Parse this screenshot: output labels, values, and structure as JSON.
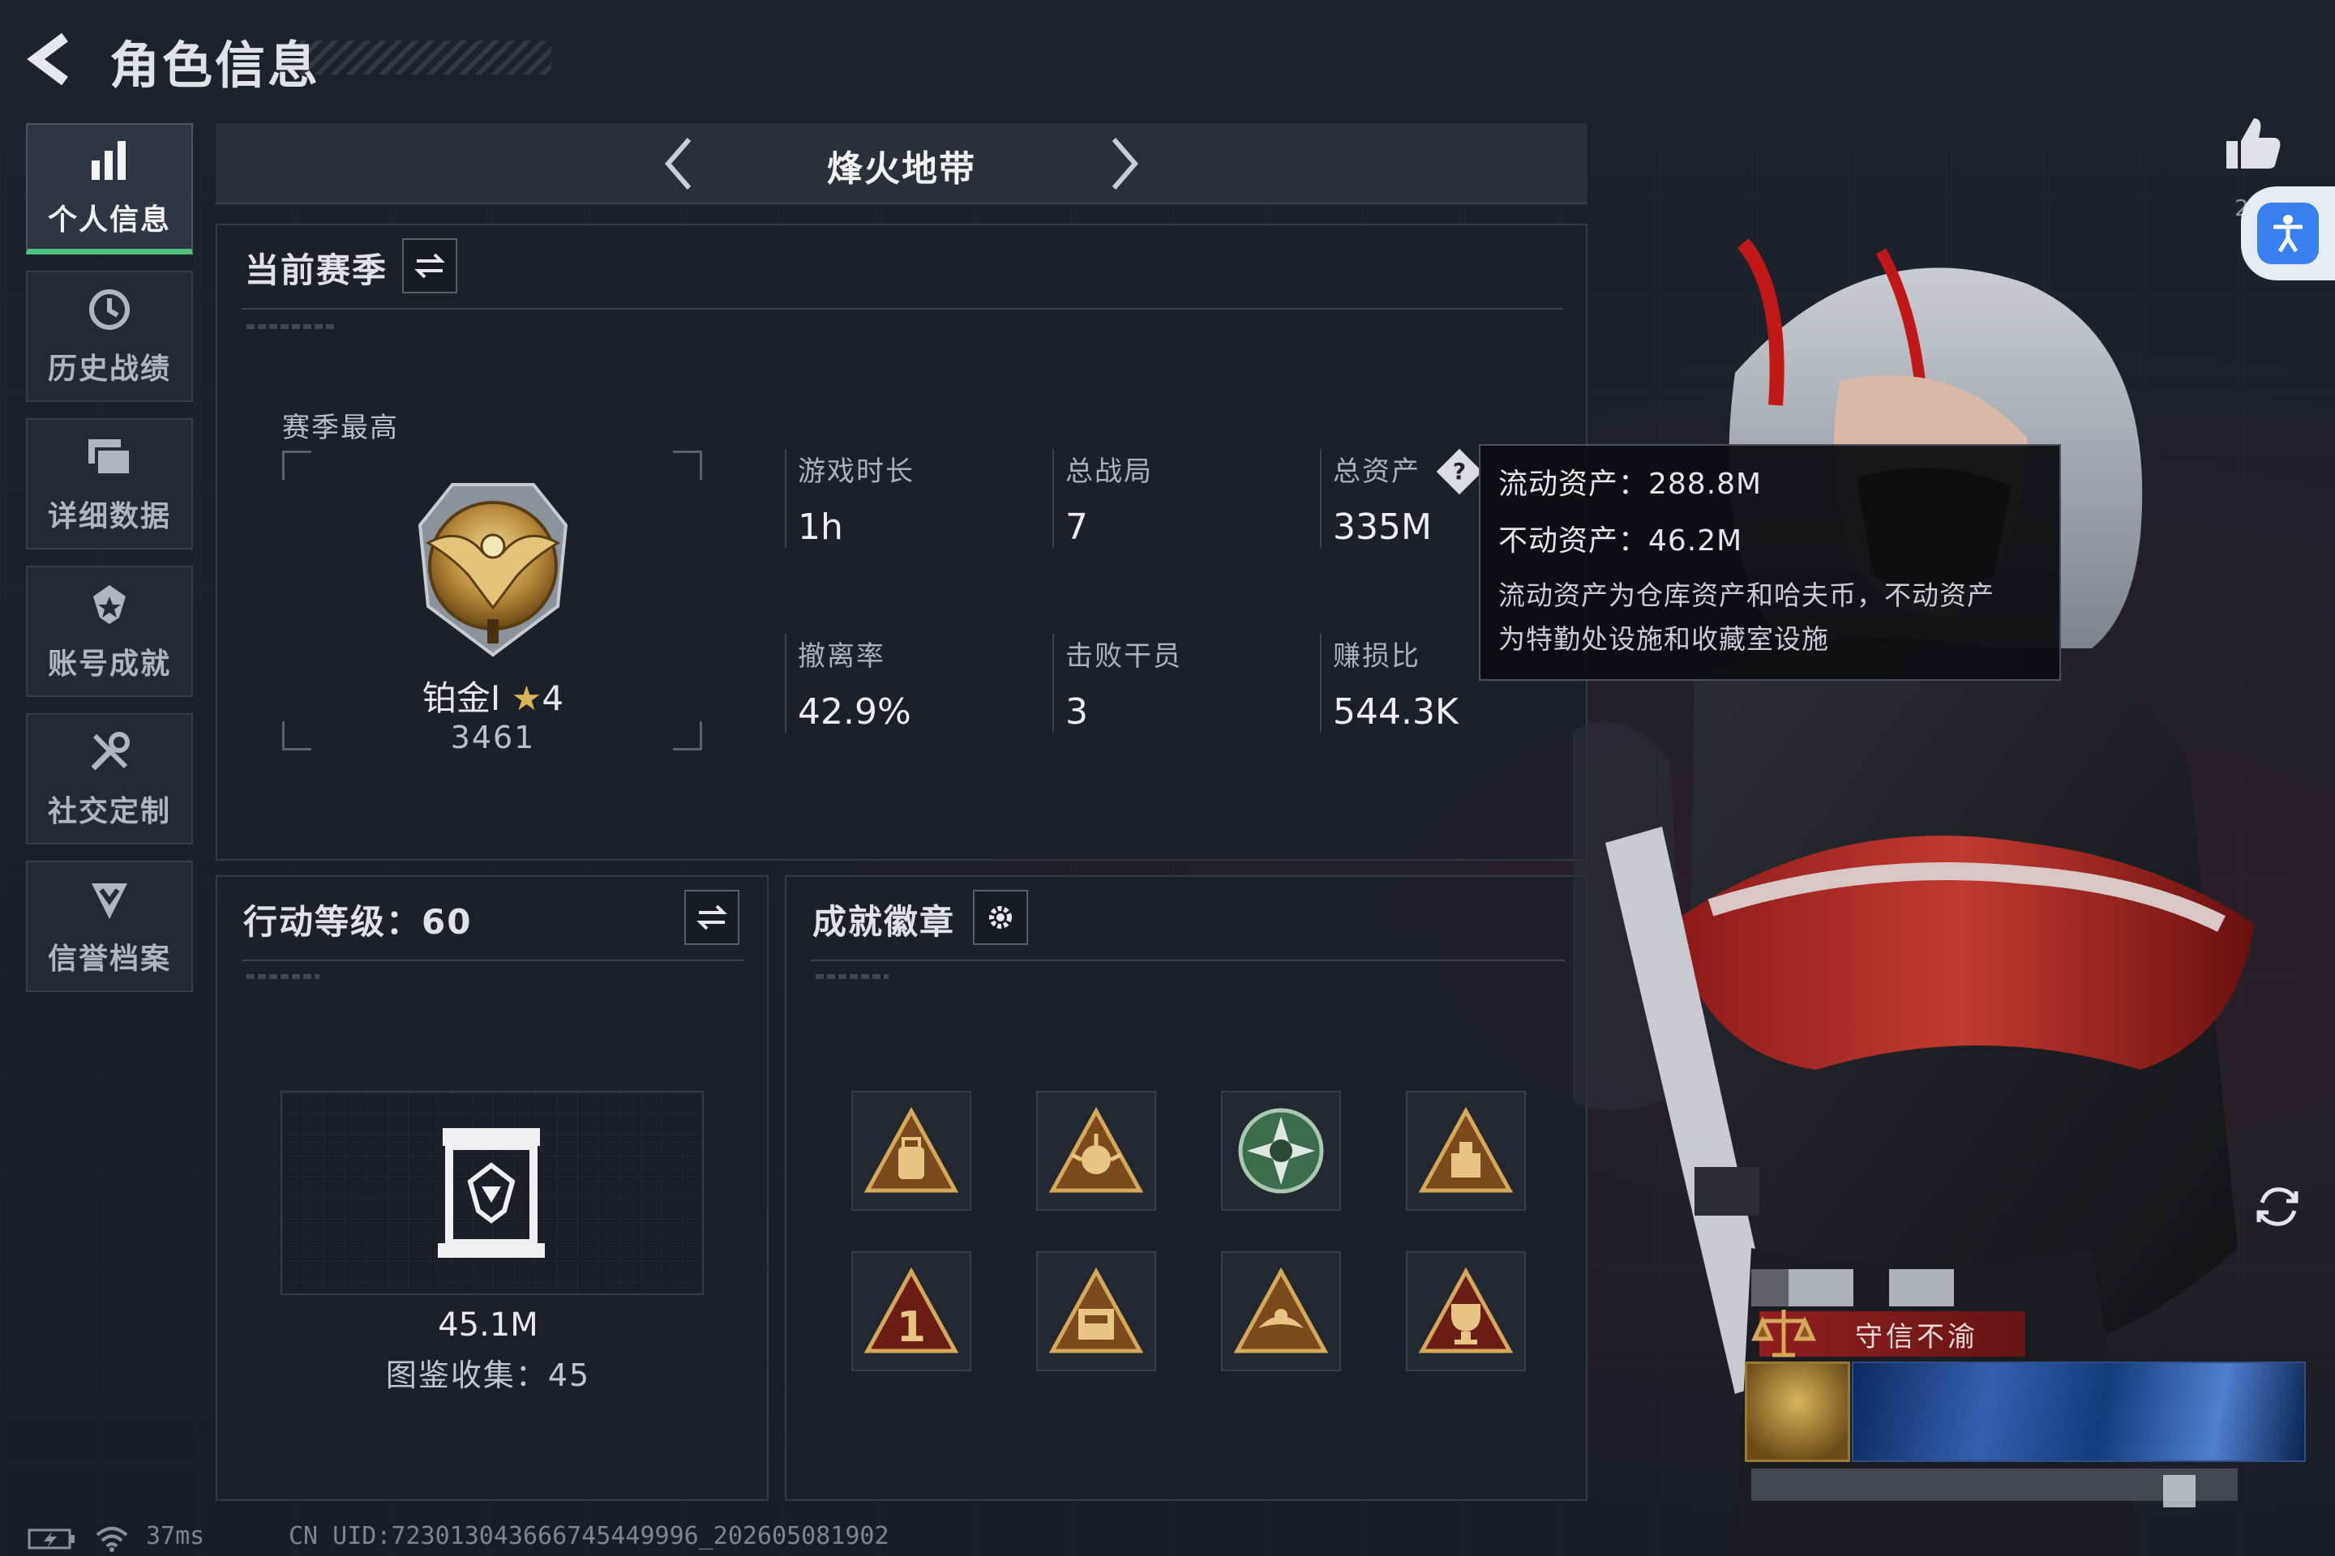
{
  "header": {
    "title": "角色信息",
    "back_icon": "arrow-left-icon"
  },
  "nav": {
    "items": [
      {
        "label": "个人信息",
        "icon": "bar-chart-icon",
        "active": true
      },
      {
        "label": "历史战绩",
        "icon": "clock-history-icon",
        "active": false
      },
      {
        "label": "详细数据",
        "icon": "stacked-cards-icon",
        "active": false
      },
      {
        "label": "账号成就",
        "icon": "achievement-icon",
        "active": false
      },
      {
        "label": "社交定制",
        "icon": "tools-icon",
        "active": false
      },
      {
        "label": "信誉档案",
        "icon": "shield-chevron-icon",
        "active": false
      }
    ]
  },
  "mode": {
    "name": "烽火地带"
  },
  "season": {
    "title": "当前赛季",
    "best_label": "赛季最高",
    "rank": {
      "name": "铂金Ⅰ",
      "stars": "4",
      "score": "3461"
    },
    "stats": [
      {
        "label": "游戏时长",
        "value": "1h"
      },
      {
        "label": "总战局",
        "value": "7"
      },
      {
        "label": "总资产",
        "value": "335M"
      },
      {
        "label": "撤离率",
        "value": "42.9%"
      },
      {
        "label": "击败干员",
        "value": "3"
      },
      {
        "label": "赚损比",
        "value": "544.3K"
      }
    ]
  },
  "asset_tooltip": {
    "liquid": "流动资产：288.8M",
    "fixed": "不动资产：46.2M",
    "desc_line1": "流动资产为仓库资产和哈夫币，不动资产",
    "desc_line2": "为特勤处设施和收藏室设施"
  },
  "action_level": {
    "title": "行动等级：60",
    "collection_value": "45.1M",
    "collection_count": "图鉴收集：45"
  },
  "achievements": {
    "title": "成就徽章",
    "badges": [
      "backpack-badge-icon",
      "medal-badge-icon",
      "green-emblem-badge-icon",
      "supply-badge-icon",
      "number-one-badge-icon",
      "ticket-badge-icon",
      "bird-badge-icon",
      "trophy-badge-icon"
    ]
  },
  "character": {
    "likes_visible": "2",
    "title_tag": "守信不渝"
  },
  "footer": {
    "ping": "37ms",
    "uid": "CN UID:723013043666745449996_202605081902"
  },
  "colors": {
    "accent_green": "#4fc27f",
    "accent_blue": "#3a7ff0",
    "gold": "#d8b557",
    "banner_red": "#961e1e"
  }
}
